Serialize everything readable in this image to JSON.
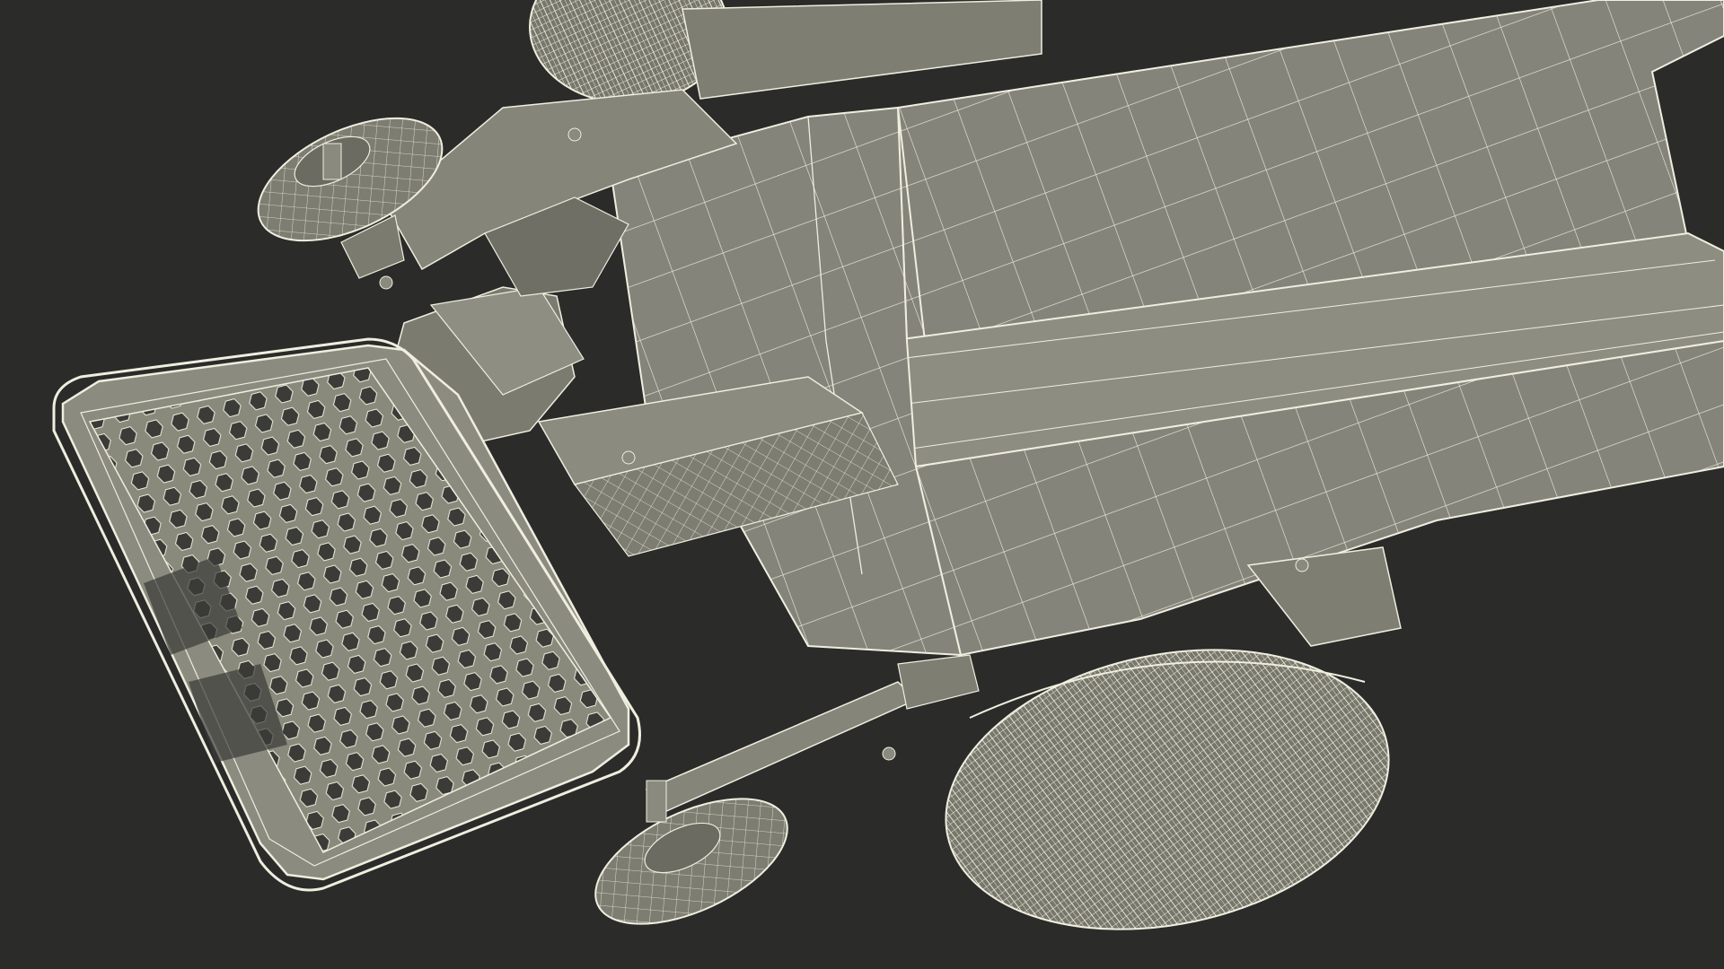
{
  "scene": {
    "background_color": "#2b2b2a",
    "surface_color": "#8a8a7c",
    "surface_dark_color": "#5f5f56",
    "wire_color": "#efeedf"
  }
}
